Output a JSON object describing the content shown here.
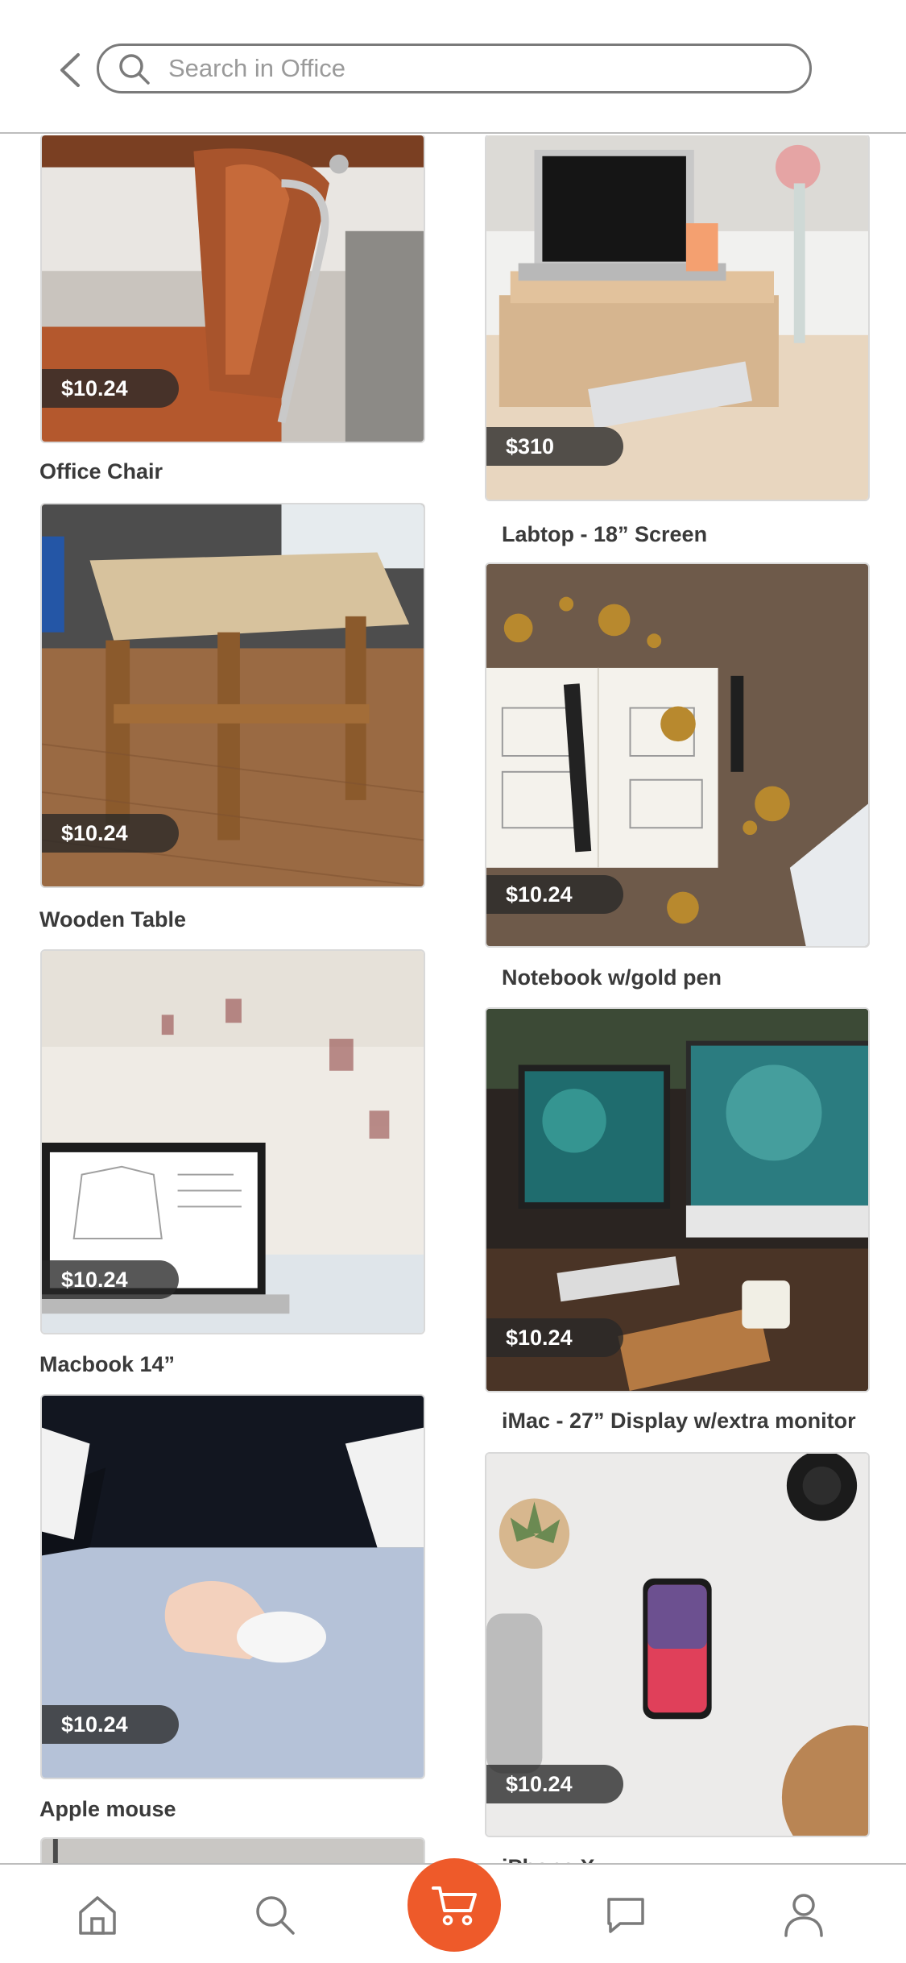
{
  "search": {
    "placeholder": "Search in Office",
    "value": ""
  },
  "products": [
    {
      "title": "Office Chair",
      "price": "$10.24"
    },
    {
      "title": "Labtop - 18” Screen",
      "price": "$310"
    },
    {
      "title": "Wooden Table",
      "price": "$10.24"
    },
    {
      "title": "Notebook w/gold pen",
      "price": "$10.24"
    },
    {
      "title": "Macbook 14”",
      "price": "$10.24"
    },
    {
      "title": "iMac - 27” Display w/extra monitor",
      "price": "$10.24"
    },
    {
      "title": "Apple mouse",
      "price": "$10.24"
    },
    {
      "title": "iPhone X",
      "price": "$10.24"
    }
  ],
  "tabbar": {
    "tabs": [
      "home-icon",
      "search-icon",
      "cart-icon",
      "chat-icon",
      "profile-icon"
    ],
    "accent": "#ee5a2a"
  }
}
